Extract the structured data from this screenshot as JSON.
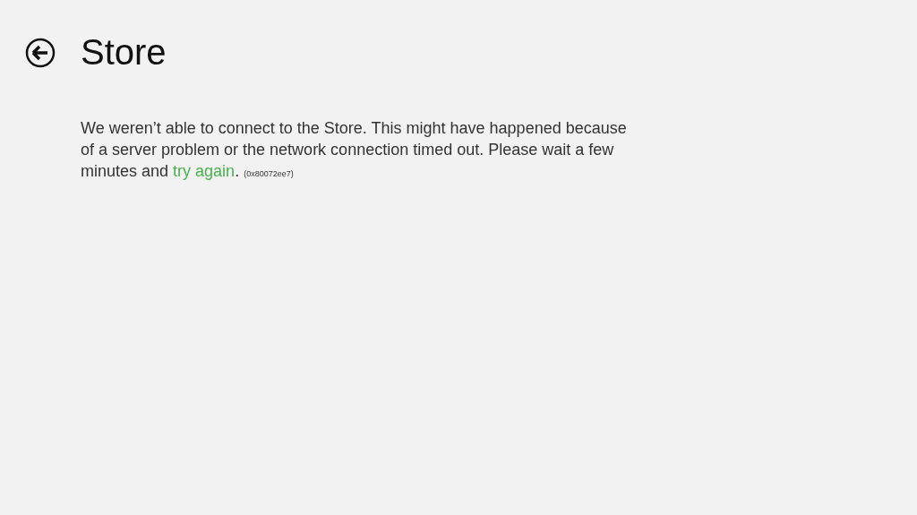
{
  "header": {
    "title": "Store"
  },
  "message": {
    "text": "We weren’t able to connect to the Store. This might have happened because of a server problem or the network connection timed out. Please wait a few minutes and",
    "link": "try again",
    "after": ".",
    "code": "(0x80072ee7)"
  }
}
